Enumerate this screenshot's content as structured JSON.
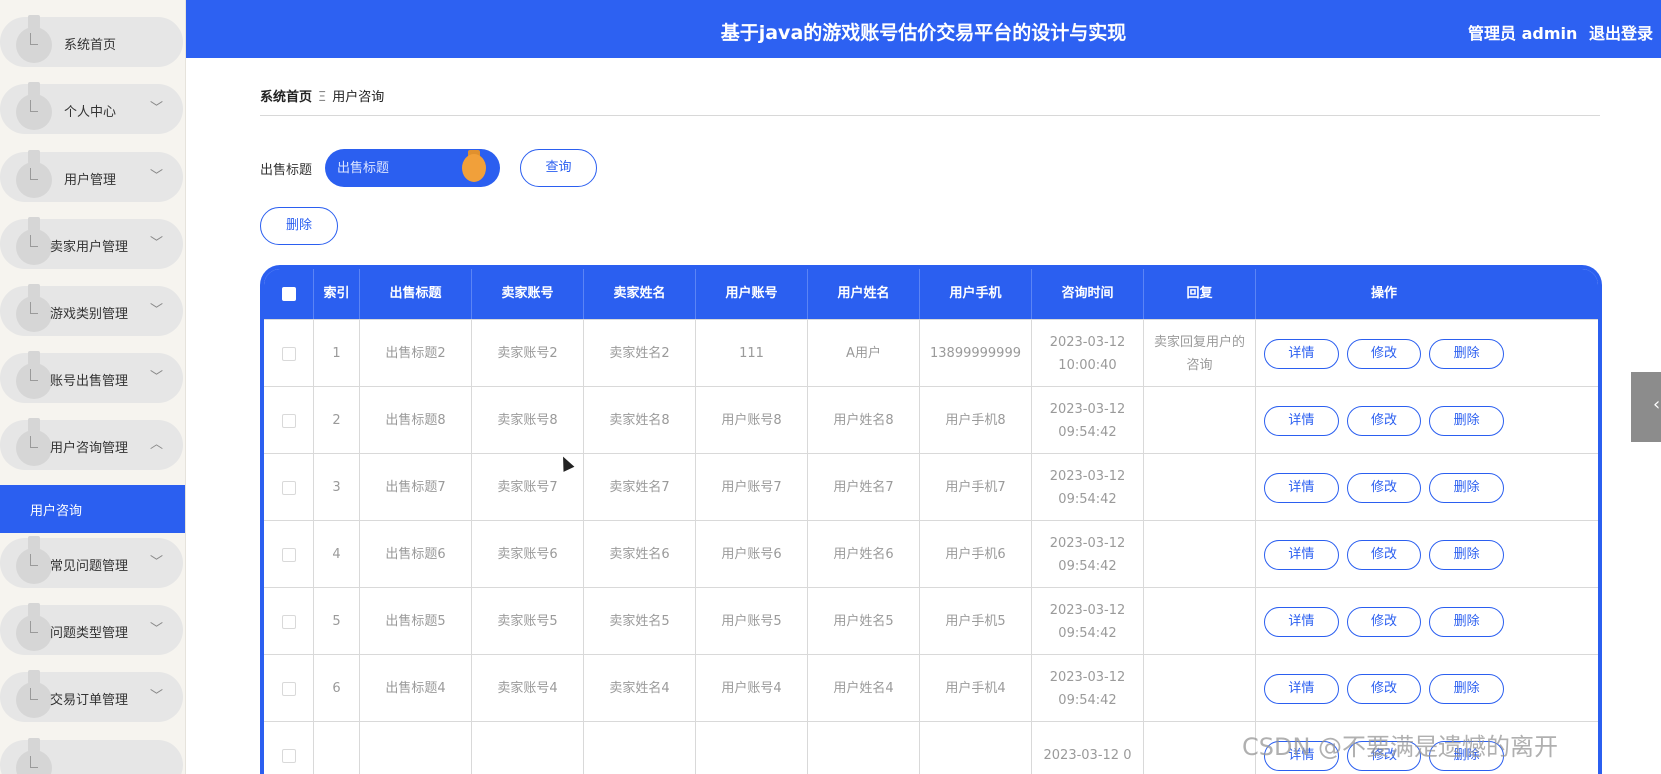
{
  "header": {
    "title": "基于java的游戏账号估价交易平台的设计与实现",
    "user_label": "管理员 admin",
    "logout_label": "退出登录"
  },
  "sidebar": {
    "items": [
      {
        "label": "系统首页",
        "chevron": ""
      },
      {
        "label": "个人中心",
        "chevron": "﹀"
      },
      {
        "label": "用户管理",
        "chevron": "﹀"
      },
      {
        "label": "卖家用户管理",
        "chevron": "﹀"
      },
      {
        "label": "游戏类别管理",
        "chevron": "﹀"
      },
      {
        "label": "账号出售管理",
        "chevron": "﹀"
      },
      {
        "label": "用户咨询管理",
        "chevron": "︿"
      },
      {
        "label": "常见问题管理",
        "chevron": "﹀"
      },
      {
        "label": "问题类型管理",
        "chevron": "﹀"
      },
      {
        "label": "交易订单管理",
        "chevron": "﹀"
      }
    ],
    "active_sub": "用户咨询"
  },
  "breadcrumb": {
    "home": "系统首页",
    "separator": "Ξ",
    "current": "用户咨询"
  },
  "search": {
    "label": "出售标题",
    "placeholder": "出售标题",
    "query_button": "查询"
  },
  "toolbar": {
    "delete_button": "删除"
  },
  "table": {
    "columns": [
      "",
      "索引",
      "出售标题",
      "卖家账号",
      "卖家姓名",
      "用户账号",
      "用户姓名",
      "用户手机",
      "咨询时间",
      "回复",
      "操作"
    ],
    "rows": [
      {
        "index": "1",
        "title": "出售标题2",
        "seller_account": "卖家账号2",
        "seller_name": "卖家姓名2",
        "user_account": "111",
        "user_name": "A用户",
        "user_phone": "13899999999",
        "time": "2023-03-12 10:00:40",
        "reply": "卖家回复用户的咨询"
      },
      {
        "index": "2",
        "title": "出售标题8",
        "seller_account": "卖家账号8",
        "seller_name": "卖家姓名8",
        "user_account": "用户账号8",
        "user_name": "用户姓名8",
        "user_phone": "用户手机8",
        "time": "2023-03-12 09:54:42",
        "reply": ""
      },
      {
        "index": "3",
        "title": "出售标题7",
        "seller_account": "卖家账号7",
        "seller_name": "卖家姓名7",
        "user_account": "用户账号7",
        "user_name": "用户姓名7",
        "user_phone": "用户手机7",
        "time": "2023-03-12 09:54:42",
        "reply": ""
      },
      {
        "index": "4",
        "title": "出售标题6",
        "seller_account": "卖家账号6",
        "seller_name": "卖家姓名6",
        "user_account": "用户账号6",
        "user_name": "用户姓名6",
        "user_phone": "用户手机6",
        "time": "2023-03-12 09:54:42",
        "reply": ""
      },
      {
        "index": "5",
        "title": "出售标题5",
        "seller_account": "卖家账号5",
        "seller_name": "卖家姓名5",
        "user_account": "用户账号5",
        "user_name": "用户姓名5",
        "user_phone": "用户手机5",
        "time": "2023-03-12 09:54:42",
        "reply": ""
      },
      {
        "index": "6",
        "title": "出售标题4",
        "seller_account": "卖家账号4",
        "seller_name": "卖家姓名4",
        "user_account": "用户账号4",
        "user_name": "用户姓名4",
        "user_phone": "用户手机4",
        "time": "2023-03-12 09:54:42",
        "reply": ""
      },
      {
        "index": "",
        "title": "",
        "seller_account": "",
        "seller_name": "",
        "user_account": "",
        "user_name": "",
        "user_phone": "",
        "time": "2023-03-12 0",
        "reply": ""
      }
    ],
    "actions": {
      "detail": "详情",
      "edit": "修改",
      "delete": "删除"
    }
  },
  "right_tab": {
    "icon": "chevron-left-icon",
    "glyph": "‹"
  },
  "watermark": "CSDN @不要满是遗憾的离开",
  "colors": {
    "primary": "#2b5ff0",
    "accent": "#f1a03a",
    "sidebar_bg": "#f6f4ef"
  }
}
